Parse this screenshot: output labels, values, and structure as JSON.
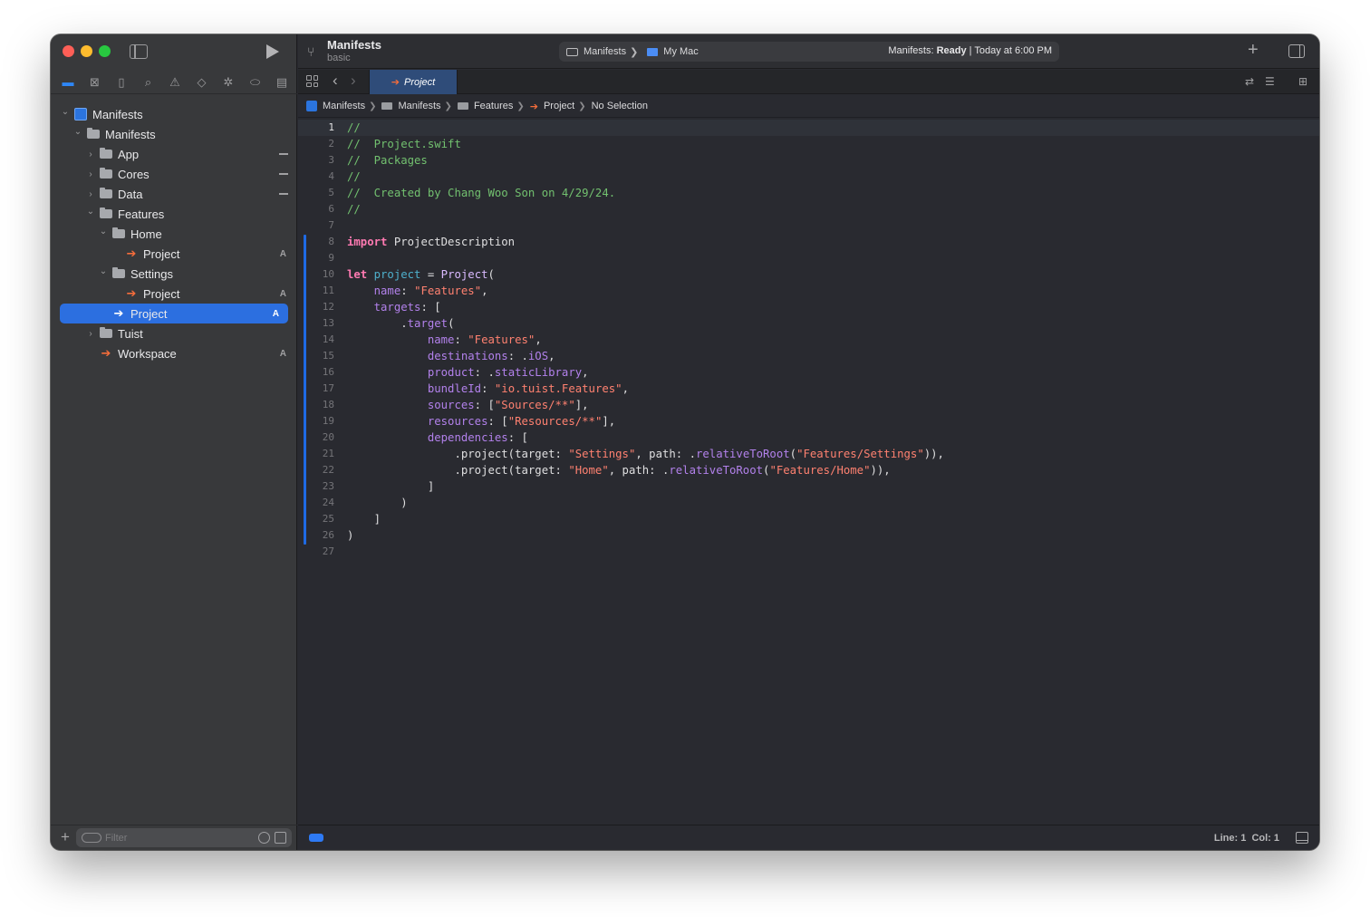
{
  "window": {
    "project_name": "Manifests",
    "branch": "basic"
  },
  "activity": {
    "scheme": "Manifests",
    "destination": "My Mac",
    "status_prefix": "Manifests:",
    "status_state": "Ready",
    "status_time": "| Today at 6:00 PM"
  },
  "navigator_icons": [
    "folder-icon",
    "source-control-icon",
    "bookmark-icon",
    "search-icon",
    "warning-icon",
    "test-icon",
    "debug-icon",
    "breakpoint-icon",
    "report-icon"
  ],
  "tree": [
    {
      "label": "Manifests",
      "depth": 0,
      "kind": "project",
      "expanded": true
    },
    {
      "label": "Manifests",
      "depth": 1,
      "kind": "folder",
      "expanded": true
    },
    {
      "label": "App",
      "depth": 2,
      "kind": "folder",
      "expanded": false,
      "status": "-"
    },
    {
      "label": "Cores",
      "depth": 2,
      "kind": "folder",
      "expanded": false,
      "status": "-"
    },
    {
      "label": "Data",
      "depth": 2,
      "kind": "folder",
      "expanded": false,
      "status": "-"
    },
    {
      "label": "Features",
      "depth": 2,
      "kind": "folder",
      "expanded": true
    },
    {
      "label": "Home",
      "depth": 3,
      "kind": "folder",
      "expanded": true
    },
    {
      "label": "Project",
      "depth": 4,
      "kind": "swift",
      "status": "A"
    },
    {
      "label": "Settings",
      "depth": 3,
      "kind": "folder",
      "expanded": true
    },
    {
      "label": "Project",
      "depth": 4,
      "kind": "swift",
      "status": "A"
    },
    {
      "label": "Project",
      "depth": 3,
      "kind": "swift",
      "status": "A",
      "selected": true
    },
    {
      "label": "Tuist",
      "depth": 2,
      "kind": "folder",
      "expanded": false
    },
    {
      "label": "Workspace",
      "depth": 2,
      "kind": "swift",
      "status": "A"
    }
  ],
  "filter": {
    "placeholder": "Filter"
  },
  "tab": {
    "label": "Project"
  },
  "jumpbar": {
    "items": [
      "Manifests",
      "Manifests",
      "Features",
      "Project",
      "No Selection"
    ]
  },
  "editor": {
    "lines": [
      [
        [
          "c-com",
          "//"
        ]
      ],
      [
        [
          "c-com",
          "//  Project.swift"
        ]
      ],
      [
        [
          "c-com",
          "//  Packages"
        ]
      ],
      [
        [
          "c-com",
          "//"
        ]
      ],
      [
        [
          "c-com",
          "//  Created by Chang Woo Son on 4/29/24."
        ]
      ],
      [
        [
          "c-com",
          "//"
        ]
      ],
      [],
      [
        [
          "c-kw",
          "import"
        ],
        [
          "",
          " ProjectDescription"
        ]
      ],
      [],
      [
        [
          "c-kw",
          "let"
        ],
        [
          "",
          " "
        ],
        [
          "c-var",
          "project"
        ],
        [
          "",
          " = "
        ],
        [
          "c-type",
          "Project"
        ],
        [
          "",
          "("
        ]
      ],
      [
        [
          "",
          "    "
        ],
        [
          "c-prop",
          "name"
        ],
        [
          "",
          ": "
        ],
        [
          "c-str",
          "\"Features\""
        ],
        [
          "",
          ","
        ]
      ],
      [
        [
          "",
          "    "
        ],
        [
          "c-prop",
          "targets"
        ],
        [
          "",
          ": ["
        ]
      ],
      [
        [
          "",
          "        ."
        ],
        [
          "c-prop",
          "target"
        ],
        [
          "",
          "("
        ]
      ],
      [
        [
          "",
          "            "
        ],
        [
          "c-prop",
          "name"
        ],
        [
          "",
          ": "
        ],
        [
          "c-str",
          "\"Features\""
        ],
        [
          "",
          ","
        ]
      ],
      [
        [
          "",
          "            "
        ],
        [
          "c-prop",
          "destinations"
        ],
        [
          "",
          ": ."
        ],
        [
          "c-prop",
          "iOS"
        ],
        [
          "",
          ","
        ]
      ],
      [
        [
          "",
          "            "
        ],
        [
          "c-prop",
          "product"
        ],
        [
          "",
          ": ."
        ],
        [
          "c-prop",
          "staticLibrary"
        ],
        [
          "",
          ","
        ]
      ],
      [
        [
          "",
          "            "
        ],
        [
          "c-prop",
          "bundleId"
        ],
        [
          "",
          ": "
        ],
        [
          "c-str",
          "\"io.tuist.Features\""
        ],
        [
          "",
          ","
        ]
      ],
      [
        [
          "",
          "            "
        ],
        [
          "c-prop",
          "sources"
        ],
        [
          "",
          ": ["
        ],
        [
          "c-str",
          "\"Sources/**\""
        ],
        [
          "",
          "],"
        ]
      ],
      [
        [
          "",
          "            "
        ],
        [
          "c-prop",
          "resources"
        ],
        [
          "",
          ": ["
        ],
        [
          "c-str",
          "\"Resources/**\""
        ],
        [
          "",
          "],"
        ]
      ],
      [
        [
          "",
          "            "
        ],
        [
          "c-prop",
          "dependencies"
        ],
        [
          "",
          ": ["
        ]
      ],
      [
        [
          "",
          "                .project(target: "
        ],
        [
          "c-str",
          "\"Settings\""
        ],
        [
          "",
          ", path: ."
        ],
        [
          "c-prop",
          "relativeToRoot"
        ],
        [
          "",
          "("
        ],
        [
          "c-str",
          "\"Features/Settings\""
        ],
        [
          "",
          ")),"
        ]
      ],
      [
        [
          "",
          "                .project(target: "
        ],
        [
          "c-str",
          "\"Home\""
        ],
        [
          "",
          ", path: ."
        ],
        [
          "c-prop",
          "relativeToRoot"
        ],
        [
          "",
          "("
        ],
        [
          "c-str",
          "\"Features/Home\""
        ],
        [
          "",
          ")),"
        ]
      ],
      [
        [
          "",
          "            ]"
        ]
      ],
      [
        [
          "",
          "        )"
        ]
      ],
      [
        [
          "",
          "    ]"
        ]
      ],
      [
        [
          "",
          ")"
        ]
      ],
      []
    ],
    "current_line": 1
  },
  "status": {
    "line_label": "Line: 1",
    "col_label": "Col: 1"
  }
}
